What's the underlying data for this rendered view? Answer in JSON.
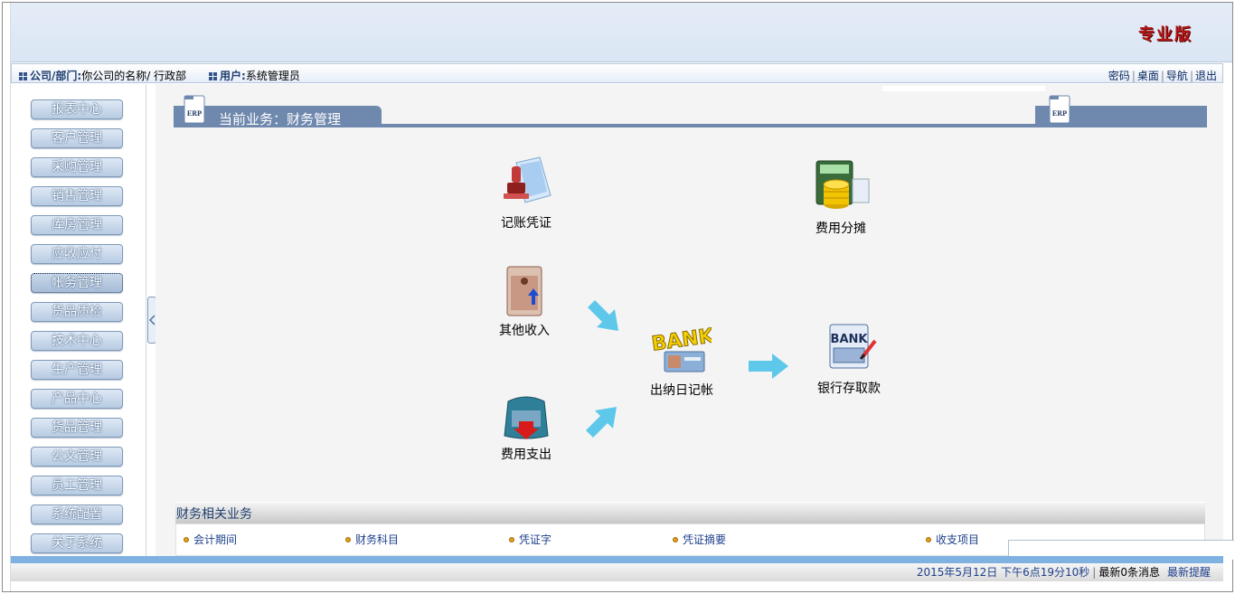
{
  "header": {
    "edition": "专业版"
  },
  "infobar": {
    "company_label": "公司/部门:",
    "company_value": "你公司的名称/ 行政部",
    "user_label": "用户:",
    "user_value": "系统管理员",
    "links": {
      "password": "密码",
      "desktop": "桌面",
      "nav": "导航",
      "logout": "退出"
    }
  },
  "sidebar": {
    "items": [
      {
        "label": "报表中心"
      },
      {
        "label": "客户管理"
      },
      {
        "label": "采购管理"
      },
      {
        "label": "销售管理"
      },
      {
        "label": "库房管理"
      },
      {
        "label": "应收应付"
      },
      {
        "label": "帐务管理"
      },
      {
        "label": "货品质检"
      },
      {
        "label": "技术中心"
      },
      {
        "label": "生产管理"
      },
      {
        "label": "产品中心"
      },
      {
        "label": "货品管理"
      },
      {
        "label": "公文管理"
      },
      {
        "label": "员工管理"
      },
      {
        "label": "系统配置"
      },
      {
        "label": "关于系统"
      }
    ],
    "active_item": "帐务管理"
  },
  "main": {
    "title": "当前业务：财务管理",
    "erp_badge": "ERP",
    "tasks": {
      "voucher": "记账凭证",
      "expense_alloc": "费用分摊",
      "other_income": "其他收入",
      "cash_journal": "出纳日记帐",
      "bank": "银行存取款",
      "expense_out": "费用支出"
    },
    "bank_sign": "BANK"
  },
  "related": {
    "title": "财务相关业务",
    "links": [
      "会计期间",
      "财务科目",
      "凭证字",
      "凭证摘要",
      "收支项目"
    ]
  },
  "footer": {
    "datetime": "2015年5月12日  下午6点19分10秒",
    "messages": "最新0条消息",
    "remind": "最新提醒"
  },
  "colors": {
    "tab_blue": "#6f88ad",
    "footer_stripe": "#7fb2e0",
    "edition_red": "#b01818",
    "arrow_cyan": "#5ec8ea"
  }
}
